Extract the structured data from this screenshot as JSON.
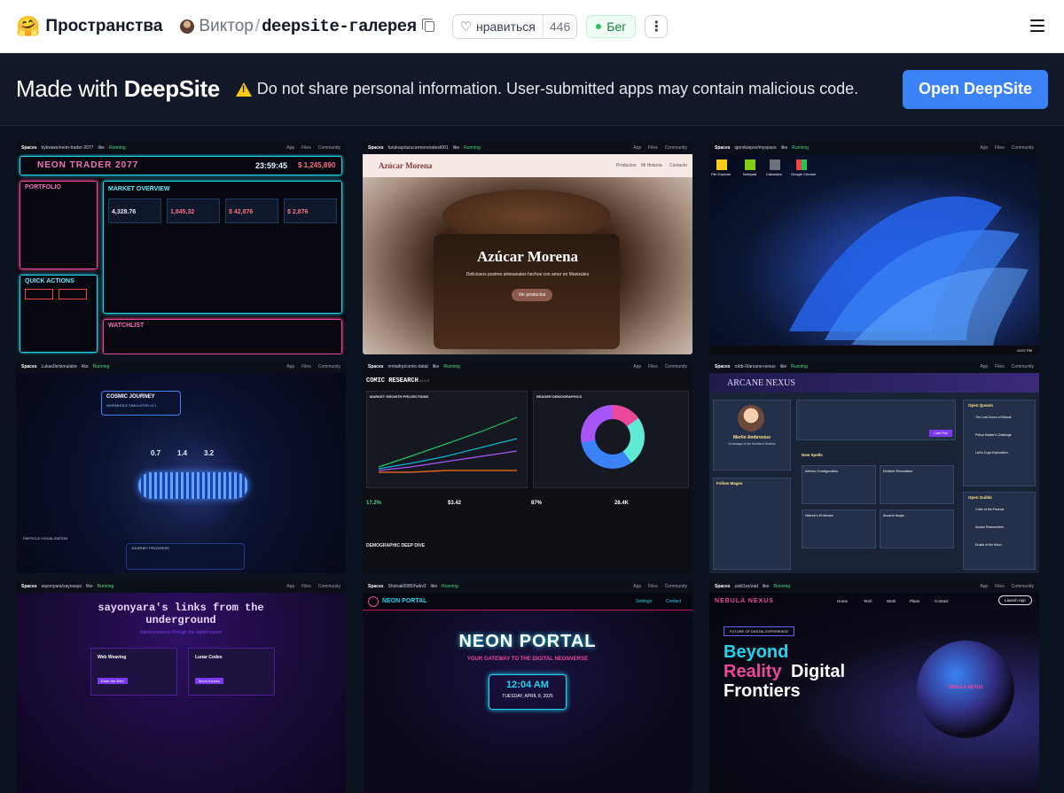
{
  "header": {
    "logo": "🤗",
    "spaces_label": "Пространства",
    "owner": "Виктор",
    "separator": "/",
    "repo": "deepsite-галерея",
    "like_label": "нравиться",
    "like_count": "446",
    "status": "Бег"
  },
  "banner": {
    "made_prefix": "Made with ",
    "made_brand": "DeepSite",
    "warning": "Do not share personal information. User-submitted apps may contain malicious code.",
    "open_button": "Open DeepSite"
  },
  "tiles": [
    {
      "path": "bybrawe/neon-trader-2077",
      "title": "NEON TRADER 2077",
      "sub": "MARKET OVERVIEW",
      "a": "PORTFOLIO",
      "b": "QUICK ACTIONS",
      "c": "WATCHLIST",
      "v1": "23:59:45",
      "v2": "$ 1,245,890",
      "s1": "4,328.76",
      "s2": "1,845.32",
      "s3": "$ 42,876",
      "s4": "$ 2,876"
    },
    {
      "path": "furukrap/azucarmorenatest001",
      "title": "Azúcar Morena",
      "sub": "Deliciosos postres artesanales hechos con amor en Manizales",
      "btn": "Ver productos",
      "nav1": "Productos",
      "nav2": "Mi Historia",
      "nav3": "Contacto"
    },
    {
      "path": "igorvkarpov/myspace",
      "i1": "File Explorer",
      "i2": "Notepad",
      "i3": "Calculator",
      "i4": "Google Chrome",
      "clock": "10:57 PM"
    },
    {
      "path": "Lukas0e/simulator",
      "title": "COSMIC JOURNEY",
      "sub": "WORMHOLE SIMULATOR v2.1",
      "v1": "0.7",
      "v2": "1.4",
      "v3": "3.2",
      "foot": "JOURNEY PROGRESS",
      "side": "PARTICLE VISUALIZATION"
    },
    {
      "path": "nmtaltrp/comic-datat",
      "title": "COMIC RESEARCH",
      "ver": "v1.1.0",
      "c1": "MARKET GROWTH PROJECTIONS",
      "c2": "READER DEMOGRAPHICS",
      "k1": "17.2%",
      "k2": "$3.42",
      "k3": "87%",
      "k4": "28.4K",
      "sec": "DEMOGRAPHIC DEEP DIVE"
    },
    {
      "path": "robb-0/arcane-nexus",
      "title": "ARCANE NEXUS",
      "name": "Merlin Ambrosius",
      "role": "Archmage of the Northern Realms",
      "q": "Open Quests",
      "f": "Follow Mages",
      "sp": "New Spells",
      "g": "Open Guilds",
      "post": "Cast Post",
      "s1": "Inferno Configuration",
      "s2": "Eldritch Revelation",
      "s3": "Nature's Embrace",
      "s4": "Arcane Aegis",
      "q1": "The Lost Crown of Eldoria",
      "q2": "Potion Master's Challenge",
      "q3": "Lich's Crypt Exploration",
      "g1": "Order of the Phoenix",
      "g2": "Arcane Researchers",
      "g3": "Druids of the Moon"
    },
    {
      "path": "sayonyara/sayosayo",
      "title": "sayonyara's links from the underground",
      "sub": "digital presence through the digital realms",
      "c1": "Web Weaving",
      "c2": "Lunar Codes",
      "b1": "Enter the Web",
      "b2": "Moon Access"
    },
    {
      "path": "Shireak0085/hubv2",
      "title": "NEON PORTAL",
      "sub": "YOUR GATEWAY TO THE DIGITAL NEONVERSE",
      "time": "12:04 AM",
      "date": "TUESDAY, APRIL 8, 2025",
      "m1": "Settings",
      "m2": "Contact"
    },
    {
      "path": "zaid1sx/zad",
      "title": "NEBULA NEXUS",
      "tag": "FUTURE OF DIGITAL EXPERIENCE",
      "h1": "Beyond",
      "h2": "Reality",
      "h3": "Digital",
      "h4": "Frontiers",
      "btn": "Launch App",
      "n1": "Home",
      "n2": "Tech",
      "n3": "Work",
      "n4": "Plans",
      "n5": "Contact",
      "orb": "NEBULA NEXUS"
    }
  ],
  "mini_bar": {
    "spaces": "Spaces",
    "like": "like",
    "running": "Running",
    "app": "App",
    "files": "Files",
    "community": "Community"
  }
}
